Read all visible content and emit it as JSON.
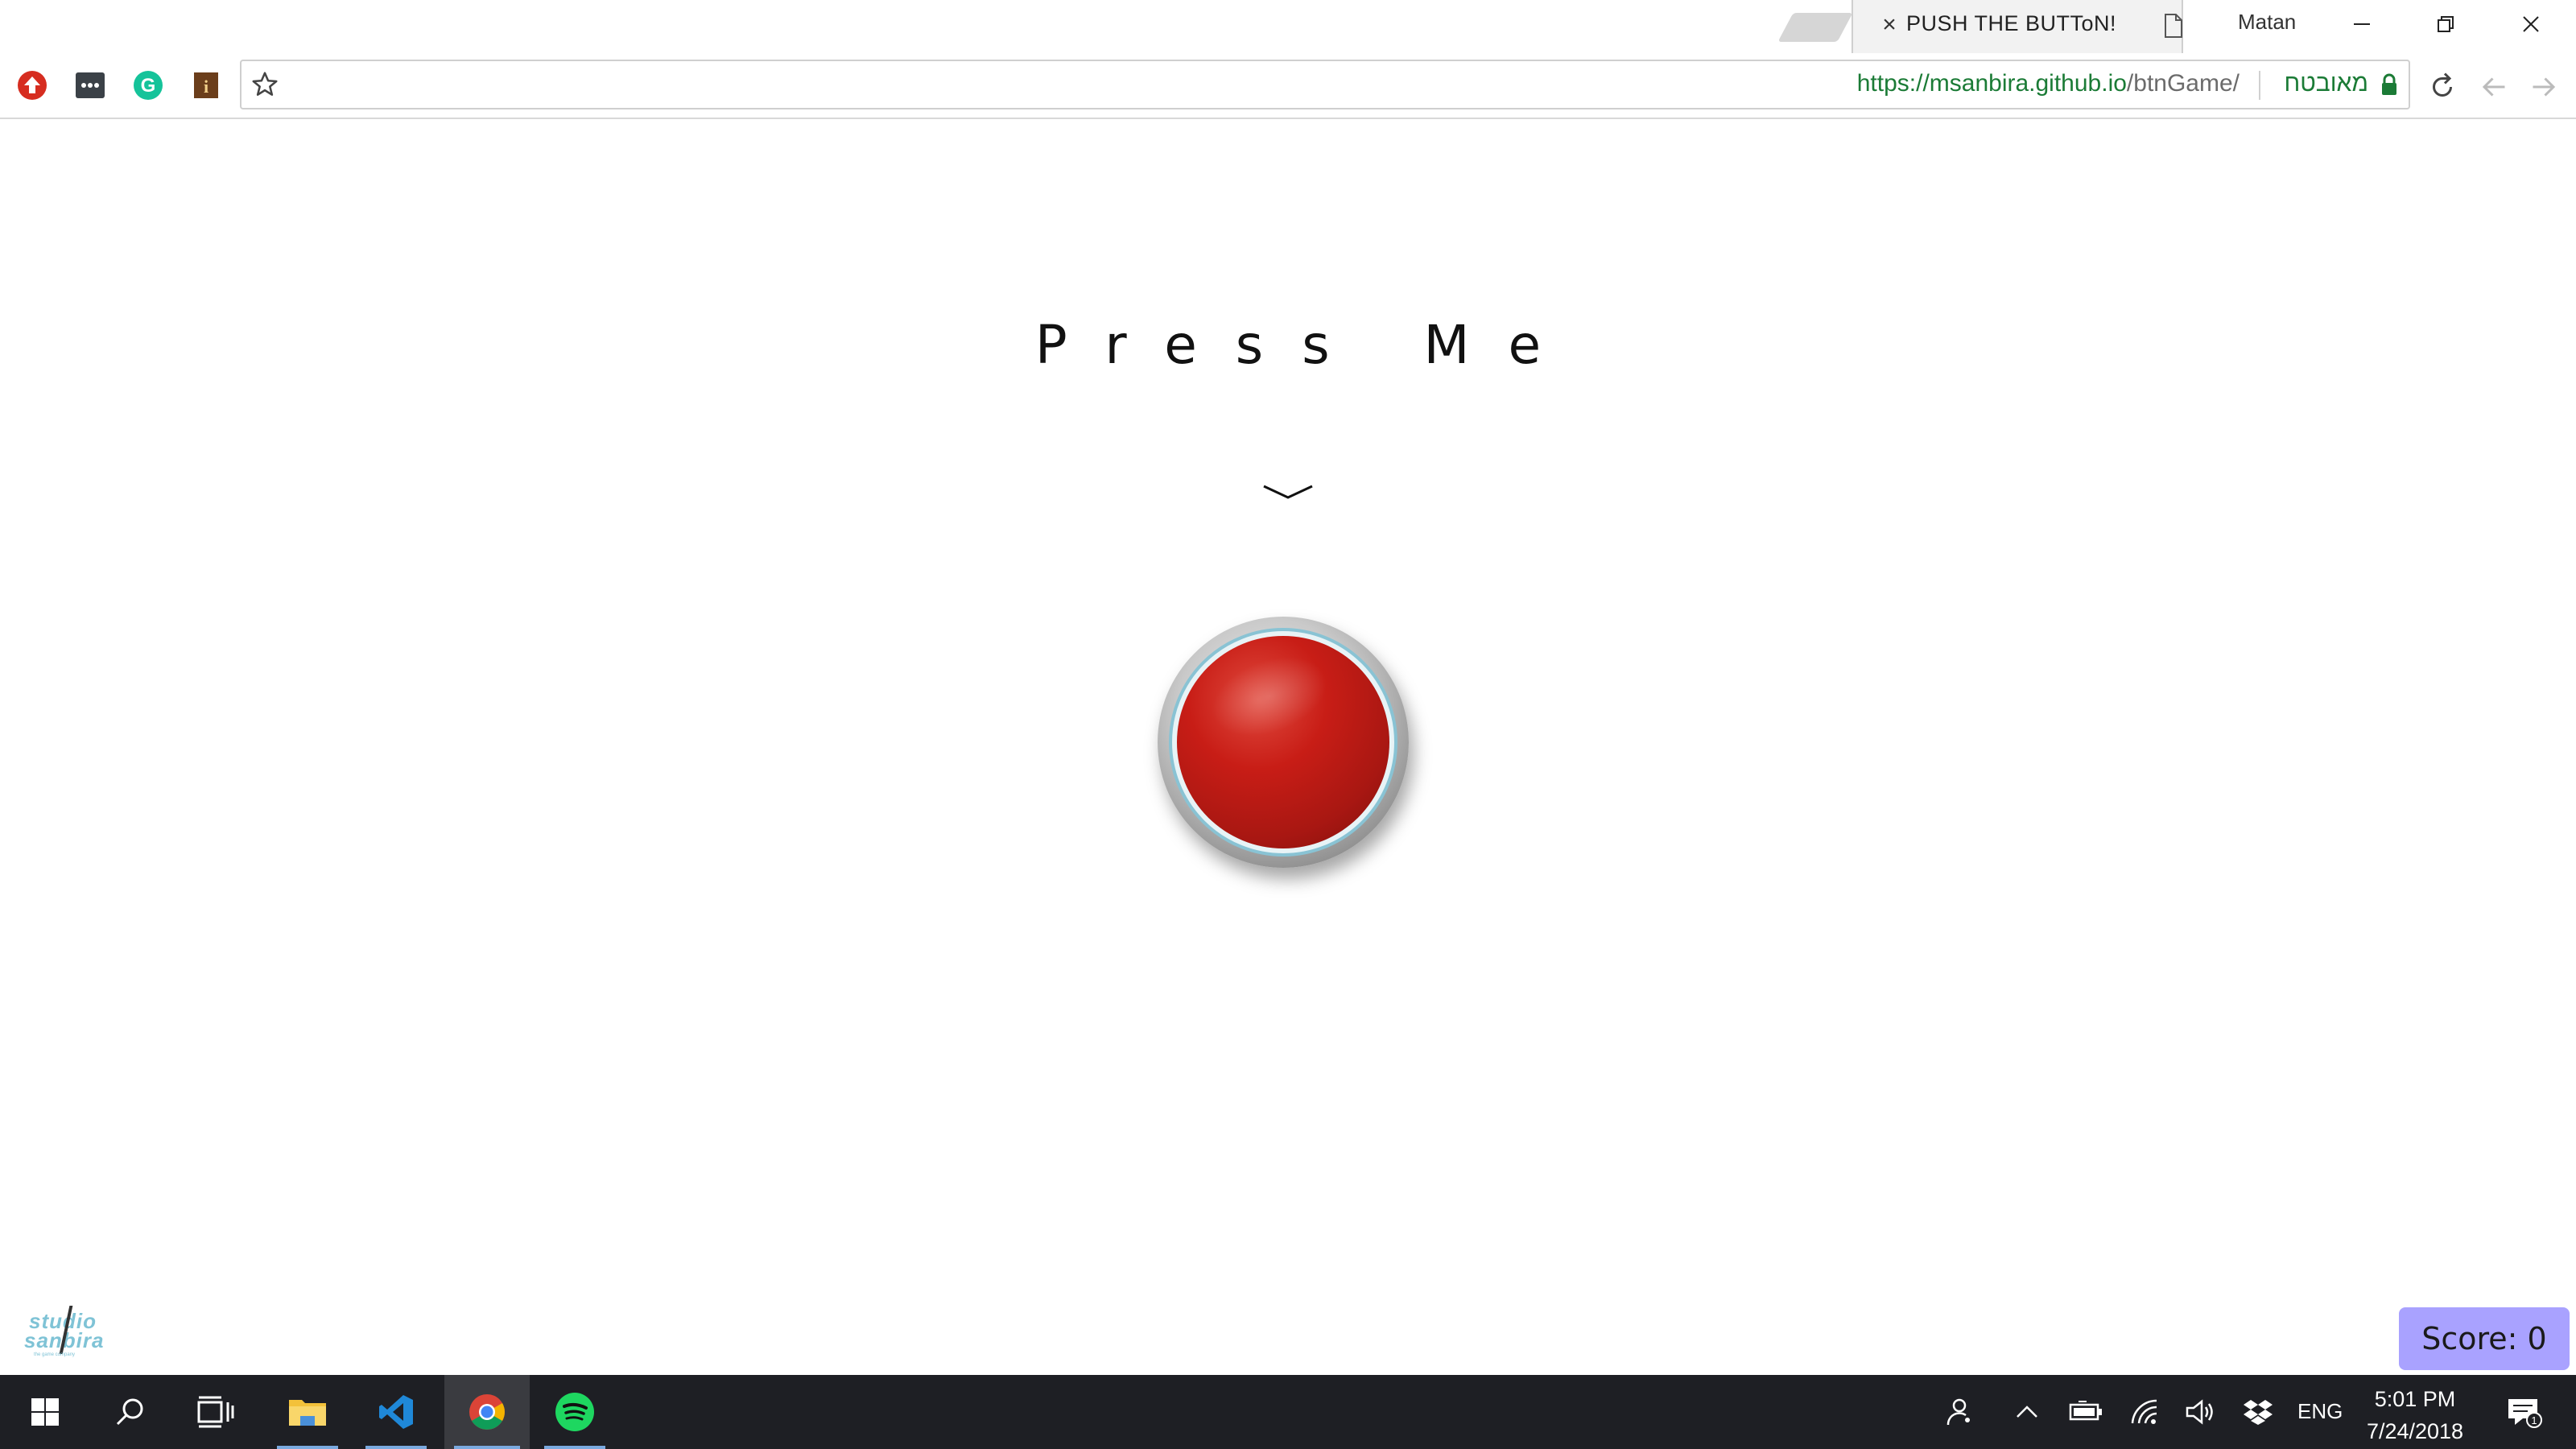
{
  "browser": {
    "tab_title": "PUSH THE BUTToN!",
    "tab_close_glyph": "×",
    "profile_name": "Matan",
    "url_scheme_host": "https://msanbira.github.io",
    "url_path": "/btnGame/",
    "security_label": "מאובטח",
    "extensions": [
      "upload-icon",
      "more-dots-icon",
      "grammarly-icon",
      "info-icon"
    ],
    "icons": {
      "bookmark": "star-icon",
      "reload": "reload-icon",
      "back": "back-arrow-icon",
      "forward": "forward-arrow-icon"
    }
  },
  "page": {
    "headline": "Press Me",
    "chevron": "chevron-down-icon",
    "button_name": "red-push-button",
    "logo": {
      "line1": "studio",
      "line2": "sanbira",
      "tagline": "the game company"
    },
    "score": "Score: 0"
  },
  "taskbar": {
    "apps": [
      "windows-start-icon",
      "search-icon",
      "task-view-icon",
      "file-explorer-icon",
      "vscode-icon",
      "chrome-icon",
      "spotify-icon"
    ],
    "language": "ENG",
    "time": "5:01 PM",
    "date": "7/24/2018",
    "notification_count": "1"
  },
  "colors": {
    "score_bg": "#a9a2ff",
    "button_red": "#c81d16",
    "secure_green": "#1b7b36",
    "taskbar_bg": "#1e1f24"
  }
}
